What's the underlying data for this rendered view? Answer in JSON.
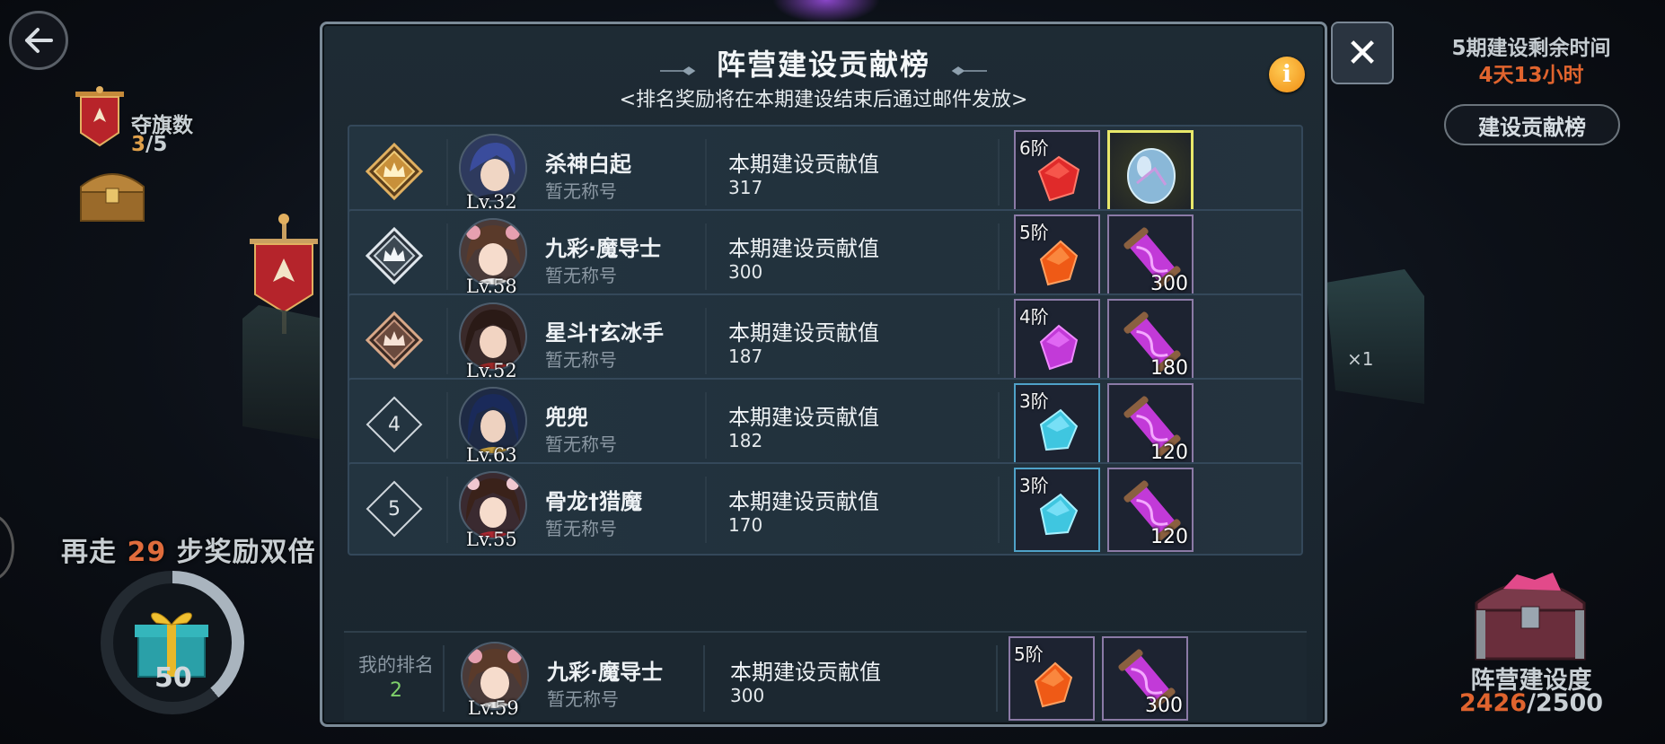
{
  "hud": {
    "flag_label": "夺旗数",
    "flag_current": "3",
    "flag_total": "/5",
    "steps_prefix": "再走 ",
    "steps_number": "29",
    "steps_suffix": " 步奖励双倍",
    "gift_count": "50",
    "timer_label": "5期建设剩余时间",
    "timer_value": "4天13小时",
    "board_button": "建设贡献榜",
    "progress_label": "阵营建设度",
    "progress_current": "2426",
    "progress_total": "/2500",
    "map_multiplier": "×1"
  },
  "modal": {
    "title": "阵营建设贡献榜",
    "subtitle": "<排名奖励将在本期建设结束后通过邮件发放>",
    "info_icon": "i",
    "close_icon": "✕"
  },
  "rows": [
    {
      "rank": "1",
      "name": "杀神白起",
      "title": "暂无称号",
      "level": "Lv.32",
      "score_label": "本期建设贡献值",
      "score": "317",
      "reward1_tier": "6阶",
      "reward2_qty": ""
    },
    {
      "rank": "2",
      "name": "九彩·魔导士",
      "title": "暂无称号",
      "level": "Lv.58",
      "score_label": "本期建设贡献值",
      "score": "300",
      "reward1_tier": "5阶",
      "reward2_qty": "300"
    },
    {
      "rank": "3",
      "name": "星斗†玄冰手",
      "title": "暂无称号",
      "level": "Lv.52",
      "score_label": "本期建设贡献值",
      "score": "187",
      "reward1_tier": "4阶",
      "reward2_qty": "180"
    },
    {
      "rank": "4",
      "name": "兜兜",
      "title": "暂无称号",
      "level": "Lv.63",
      "score_label": "本期建设贡献值",
      "score": "182",
      "reward1_tier": "3阶",
      "reward2_qty": "120"
    },
    {
      "rank": "5",
      "name": "骨龙†猎魔",
      "title": "暂无称号",
      "level": "Lv.55",
      "score_label": "本期建设贡献值",
      "score": "170",
      "reward1_tier": "3阶",
      "reward2_qty": "120"
    }
  ],
  "my_rank": {
    "label": "我的排名",
    "rank": "2",
    "name": "九彩·魔导士",
    "title": "暂无称号",
    "level": "Lv.59",
    "score_label": "本期建设贡献值",
    "score": "300",
    "reward1_tier": "5阶",
    "reward2_qty": "300"
  },
  "colors": {
    "accent_orange": "#e0642e",
    "gem_red": "#e02a2a",
    "gem_orange": "#ef5a16",
    "gem_purple": "#c23ad8",
    "gem_cyan": "#3fc6e0",
    "gold_frame": "#e8e86a",
    "my_rank_green": "#7fd06a"
  },
  "icons": {
    "back": "back-arrow-icon",
    "close": "close-icon",
    "info": "info-icon",
    "rank1": "gold-crown-badge-icon",
    "rank2": "silver-crown-badge-icon",
    "rank3": "bronze-crown-badge-icon",
    "gem": "crystal-gem-icon",
    "egg": "crystal-egg-icon",
    "scroll": "purple-scroll-icon",
    "gift": "gift-box-icon",
    "chest": "treasure-chest-icon",
    "flag": "faction-flag-icon"
  }
}
